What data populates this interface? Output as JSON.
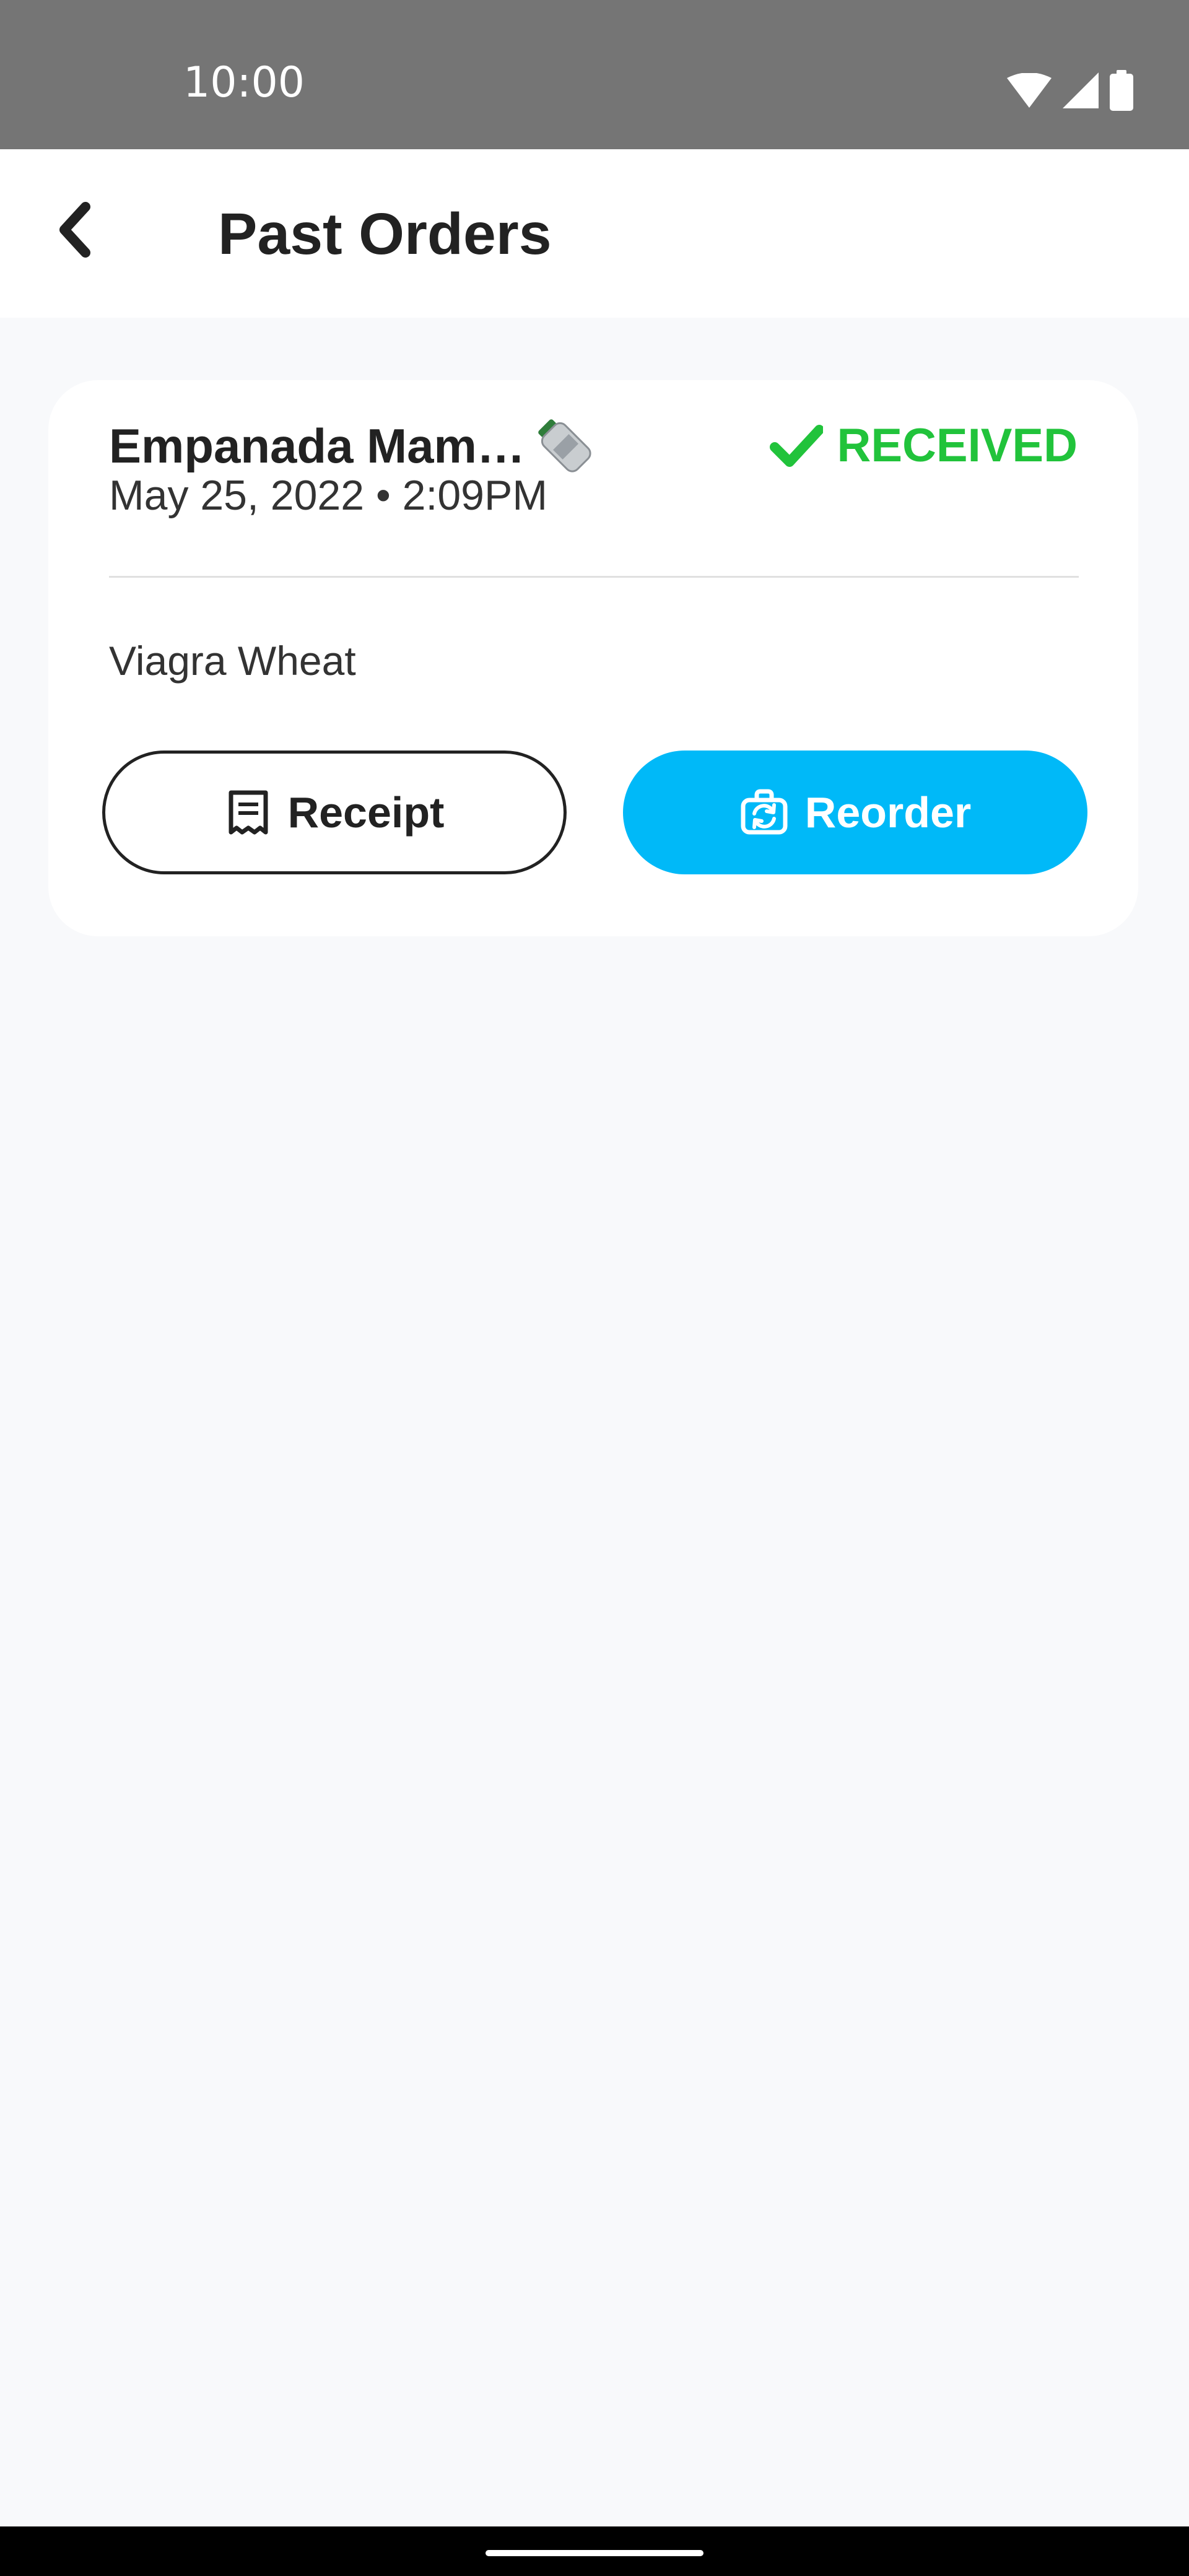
{
  "status_bar": {
    "time": "10:00",
    "icons": [
      "wifi-icon",
      "signal-icon",
      "battery-icon"
    ]
  },
  "app_bar": {
    "back_icon": "chevron-left-icon",
    "title": "Past Orders"
  },
  "orders": [
    {
      "restaurant": "Empanada Mam…",
      "date": "May 25, 2022 • 2:09PM",
      "status": "RECEIVED",
      "item": "Viagra Wheat",
      "receipt_label": "Receipt",
      "reorder_label": "Reorder"
    }
  ],
  "colors": {
    "status_bar": "#757575",
    "background": "#f8f9fb",
    "success": "#21c33b",
    "accent": "#00b9f8"
  }
}
